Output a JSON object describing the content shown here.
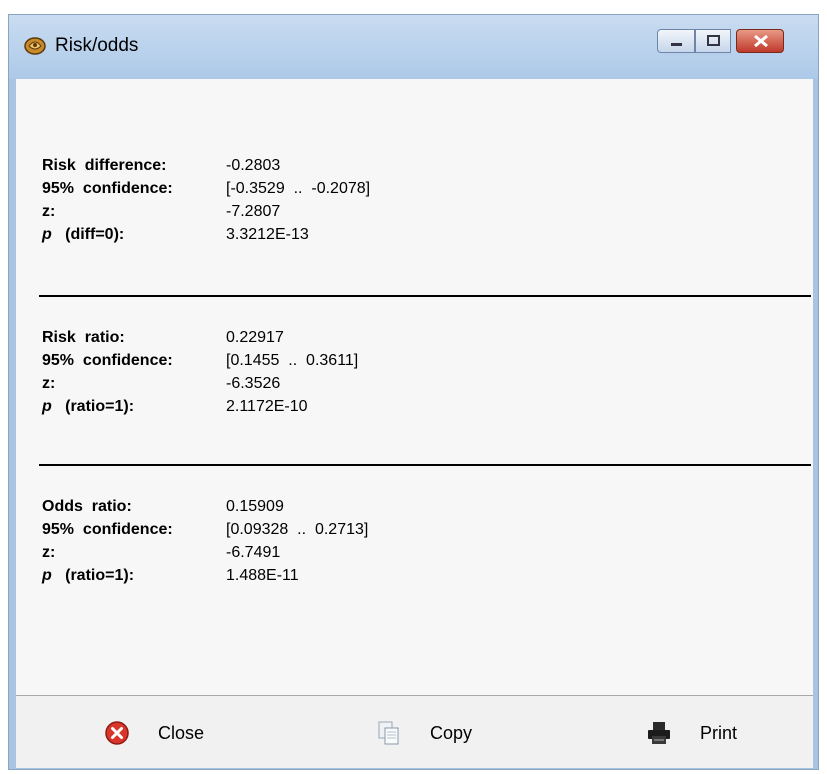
{
  "window": {
    "title": "Risk/odds"
  },
  "sections": [
    {
      "rows": [
        {
          "label": "Risk  difference:",
          "value": "-0.2803"
        },
        {
          "label": "95%  confidence:",
          "value": "[-0.3529  ..  -0.2078]"
        },
        {
          "label": "z:",
          "value": "-7.2807"
        },
        {
          "label_p": "p",
          "label": "   (diff=0):",
          "value": "3.3212E-13"
        }
      ]
    },
    {
      "rows": [
        {
          "label": "Risk  ratio:",
          "value": "0.22917"
        },
        {
          "label": "95%  confidence:",
          "value": "[0.1455  ..  0.3611]"
        },
        {
          "label": "z:",
          "value": "-6.3526"
        },
        {
          "label_p": "p",
          "label": "   (ratio=1):",
          "value": "2.1172E-10"
        }
      ]
    },
    {
      "rows": [
        {
          "label": "Odds  ratio:",
          "value": "0.15909"
        },
        {
          "label": "95%  confidence:",
          "value": "[0.09328  ..  0.2713]"
        },
        {
          "label": "z:",
          "value": "-6.7491"
        },
        {
          "label_p": "p",
          "label": "   (ratio=1):",
          "value": "1.488E-11"
        }
      ]
    }
  ],
  "buttons": {
    "close": "Close",
    "copy": "Copy",
    "print": "Print"
  },
  "colors": {
    "titlebar": "#b8d1ec",
    "content_bg": "#f7f7f7",
    "close_icon": "#d9352b"
  }
}
